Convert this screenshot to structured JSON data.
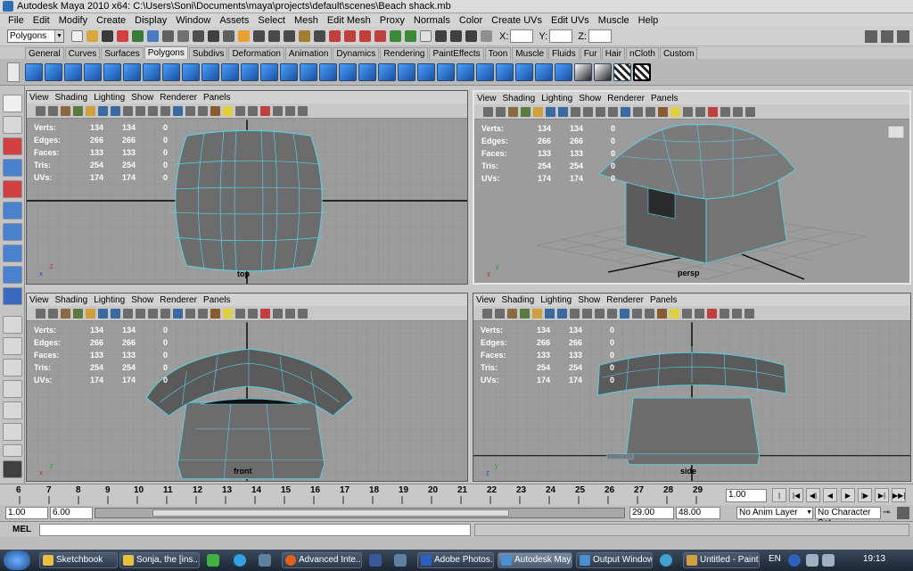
{
  "window": {
    "title": "Autodesk Maya 2010 x64: C:\\Users\\Soni\\Documents\\maya\\projects\\default\\scenes\\Beach shack.mb"
  },
  "menus": [
    "File",
    "Edit",
    "Modify",
    "Create",
    "Display",
    "Window",
    "Assets",
    "Select",
    "Mesh",
    "Edit Mesh",
    "Proxy",
    "Normals",
    "Color",
    "Create UVs",
    "Edit UVs",
    "Muscle",
    "Help"
  ],
  "status_line": {
    "mode": "Polygons",
    "x_label": "X:",
    "y_label": "Y:",
    "z_label": "Z:"
  },
  "shelf_tabs": [
    "General",
    "Curves",
    "Surfaces",
    "Polygons",
    "Subdivs",
    "Deformation",
    "Animation",
    "Dynamics",
    "Rendering",
    "PaintEffects",
    "Toon",
    "Muscle",
    "Fluids",
    "Fur",
    "Hair",
    "nCloth",
    "Custom"
  ],
  "active_shelf_tab": "Polygons",
  "viewport_menu": [
    "View",
    "Shading",
    "Lighting",
    "Show",
    "Renderer",
    "Panels"
  ],
  "hud": {
    "rows": [
      {
        "label": "Verts:",
        "a": "134",
        "b": "134",
        "c": "0"
      },
      {
        "label": "Edges:",
        "a": "266",
        "b": "266",
        "c": "0"
      },
      {
        "label": "Faces:",
        "a": "133",
        "b": "133",
        "c": "0"
      },
      {
        "label": "Tris:",
        "a": "254",
        "b": "254",
        "c": "0"
      },
      {
        "label": "UVs:",
        "a": "174",
        "b": "174",
        "c": "0"
      }
    ]
  },
  "viewports": {
    "top": "top",
    "persp": "persp",
    "front": "front",
    "side": "side"
  },
  "timeline": {
    "ticks": [
      "6",
      "7",
      "8",
      "9",
      "10",
      "11",
      "12",
      "13",
      "14",
      "15",
      "16",
      "17",
      "18",
      "19",
      "20",
      "21",
      "22",
      "23",
      "24",
      "25",
      "26",
      "27",
      "28",
      "29"
    ],
    "current_frame": "1.00"
  },
  "range": {
    "start": "1.00",
    "range_start": "6.00",
    "range_end": "29.00",
    "end": "48.00",
    "anim_layer": "No Anim Layer",
    "char_set": "No Character Set"
  },
  "command_line": {
    "label": "MEL"
  },
  "taskbar": {
    "tasks": [
      {
        "label": "Sketchbook",
        "color": "#e8c040"
      },
      {
        "label": "Sonja, the [ins...",
        "color": "#e8c040"
      },
      {
        "label": "Advanced Inte...",
        "color": "#e06020"
      },
      {
        "label": "Adobe Photos...",
        "color": "#2a60c0"
      },
      {
        "label": "Autodesk May...",
        "color": "#4a90d0"
      },
      {
        "label": "Output Window",
        "color": "#4a90d0"
      },
      {
        "label": "Untitled - Paint",
        "color": "#d0a040"
      }
    ],
    "lang": "EN",
    "clock": "19:13"
  }
}
